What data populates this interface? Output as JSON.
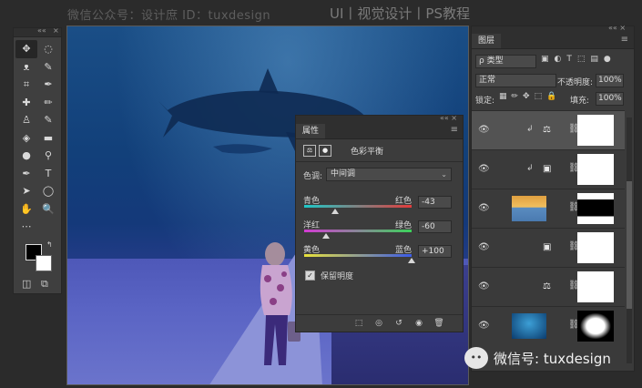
{
  "watermark": {
    "left": "微信公众号：设计庶  ID：tuxdesign",
    "right": "UI丨视觉设计丨PS教程",
    "bottom": "微信号: tuxdesign"
  },
  "toolbar": {
    "collapse_glyph": "««",
    "close_glyph": "×",
    "tools": [
      "move-tool",
      "marquee-tool",
      "lasso-tool",
      "quick-select-tool",
      "crop-tool",
      "eyedropper-tool",
      "healing-brush-tool",
      "brush-tool",
      "clone-stamp-tool",
      "history-brush-tool",
      "eraser-tool",
      "gradient-tool",
      "blur-tool",
      "dodge-tool",
      "pen-tool",
      "type-tool",
      "path-select-tool",
      "shape-tool",
      "hand-tool",
      "zoom-tool",
      "more-tools"
    ],
    "glyphs": [
      "✥",
      "◌",
      "ᴥ",
      "✎",
      "⌗",
      "✒",
      "✚",
      "✏",
      "♙",
      "✎",
      "◈",
      "▬",
      "●",
      "⚲",
      "✒",
      "T",
      "➤",
      "◯",
      "✋",
      "🔍",
      "⋯"
    ]
  },
  "properties": {
    "tab": "属性",
    "menu_glyph": "≡",
    "collapse_glyph": "«« ×",
    "adjustment_title": "色彩平衡",
    "tone_label": "色调:",
    "tone_value": "中间调",
    "sliders": [
      {
        "left": "青色",
        "right": "红色",
        "value": "-43",
        "position": -43
      },
      {
        "left": "洋红",
        "right": "绿色",
        "value": "-60",
        "position": -60
      },
      {
        "left": "黄色",
        "right": "蓝色",
        "value": "+100",
        "position": 100
      }
    ],
    "preserve_label": "保留明度",
    "preserve_checked": true,
    "footer_icons": [
      "clip-to-layer-icon",
      "view-previous-icon",
      "reset-icon",
      "visibility-icon",
      "delete-icon"
    ],
    "footer_glyphs": [
      "⬚",
      "◎",
      "↺",
      "◉",
      "🗑"
    ]
  },
  "layers": {
    "tab": "图层",
    "menu_glyph": "≡",
    "collapse_glyph": "««  ×",
    "filter_label": "ρ 类型",
    "filter_icons": "▣◐T⬚▤●",
    "blend_mode": "正常",
    "opacity_label": "不透明度:",
    "opacity_value": "100%",
    "lock_label": "锁定:",
    "lock_icons": "▦✏✥⬚🔒",
    "fill_label": "填充:",
    "fill_value": "100%",
    "items": [
      {
        "kind": "color-balance",
        "clipped": true,
        "selected": true
      },
      {
        "kind": "photo-filter",
        "clipped": true,
        "selected": false
      },
      {
        "kind": "image",
        "clipped": false,
        "selected": false
      },
      {
        "kind": "photo-filter",
        "clipped": false,
        "selected": false
      },
      {
        "kind": "color-balance",
        "clipped": false,
        "selected": false
      },
      {
        "kind": "ocean-image",
        "clipped": false,
        "selected": false
      }
    ]
  }
}
